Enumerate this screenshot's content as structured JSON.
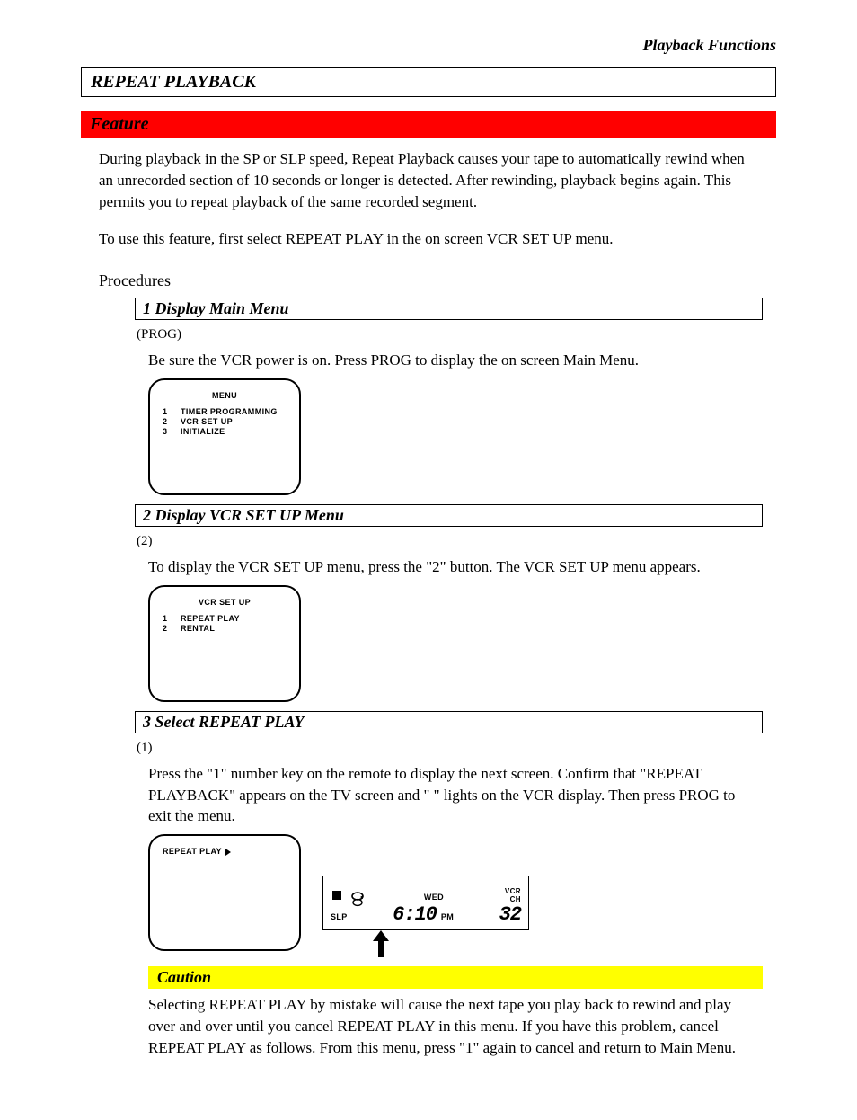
{
  "header": {
    "section_name": "Playback Functions"
  },
  "title": "REPEAT PLAYBACK",
  "feature_bar": "Feature",
  "body_paragraphs": [
    "During playback in the SP or SLP speed, Repeat Playback causes your tape to automatically rewind when an unrecorded section of 10 seconds or longer is detected. After rewinding, playback begins again. This permits you to repeat playback of the same recorded segment.",
    "To use this feature, first select REPEAT PLAY in the on screen VCR SET UP menu."
  ],
  "procedures_label": "Procedures",
  "steps": [
    {
      "title": "1 Display Main Menu",
      "sub": "(PROG)",
      "body": "Be sure the VCR power is on. Press PROG to display the on screen Main Menu.",
      "screen": {
        "heading": "MENU",
        "items": [
          "TIMER PROGRAMMING",
          "VCR SET UP",
          "INITIALIZE"
        ]
      }
    },
    {
      "title": "2 Display VCR SET UP Menu",
      "sub": "(2)",
      "body": "To display the VCR SET UP menu, press the \"2\" button. The VCR SET UP menu appears.",
      "screen": {
        "heading": "VCR SET UP",
        "items": [
          "REPEAT PLAY",
          "RENTAL"
        ]
      }
    },
    {
      "title": "3 Select REPEAT PLAY",
      "sub": "(1)",
      "body": "Press the \"1\" number key on the remote to display the next screen. Confirm that \"REPEAT PLAYBACK\" appears on the TV screen and \"  \" lights on the VCR display. Then press PROG to exit the menu.",
      "screen": {
        "heading": "",
        "line": "REPEAT PLAY"
      },
      "vcr": {
        "wed": "WED",
        "vcr": "VCR",
        "ch_label": "CH",
        "slp": "SLP",
        "time": "6:10",
        "ampm": "PM",
        "ch": "32"
      }
    }
  ],
  "caution": {
    "label": "Caution",
    "body": "Selecting REPEAT PLAY by mistake will cause the next tape you play back to rewind and play over and over until you cancel REPEAT PLAY in this menu. If you have this problem, cancel REPEAT PLAY as follows. From this menu, press \"1\" again to cancel and return to Main Menu."
  }
}
